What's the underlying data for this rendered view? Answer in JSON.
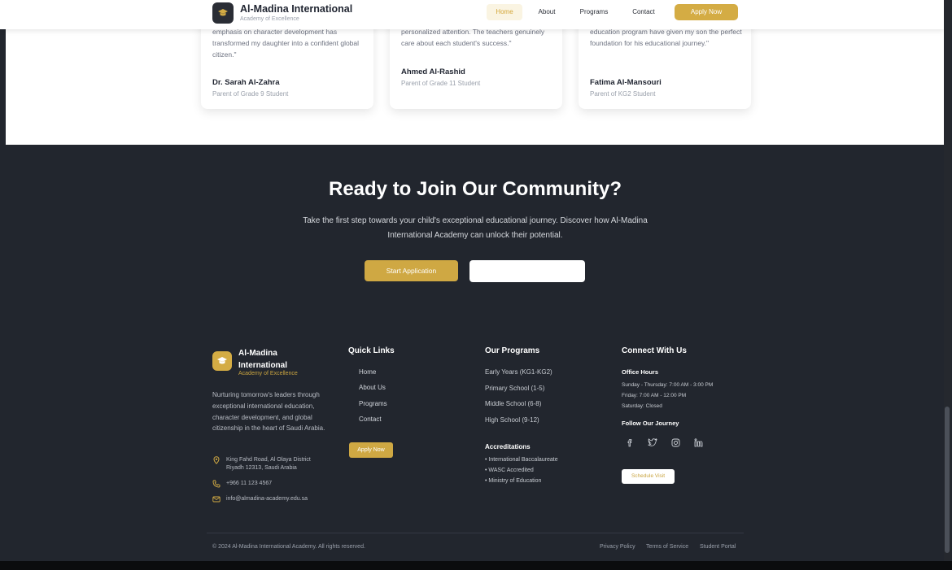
{
  "navbar": {
    "brand": "Al-Madina International",
    "tagline": "Academy of Excellence",
    "links": [
      "Home",
      "About",
      "Programs",
      "Contact"
    ],
    "apply": "Apply Now"
  },
  "testimonials": [
    {
      "quote": "emphasis on character development has transformed my daughter into a confident global citizen.\"",
      "author": "Dr. Sarah Al-Zahra",
      "role": "Parent of Grade 9 Student"
    },
    {
      "quote": "personalized attention. The teachers genuinely care about each student's success.\"",
      "author": "Ahmed Al-Rashid",
      "role": "Parent of Grade 11 Student"
    },
    {
      "quote": "education program have given my son the perfect foundation for his educational journey.\"",
      "author": "Fatima Al-Mansouri",
      "role": "Parent of KG2 Student"
    }
  ],
  "cta": {
    "title": "Ready to Join Our Community?",
    "description": "Take the first step towards your child's exceptional educational journey. Discover how Al-Madina International Academy can unlock their potential.",
    "start_button": "Start Application"
  },
  "footer": {
    "brand": "Al-Madina International",
    "tagline": "Academy of Excellence",
    "description": "Nurturing tomorrow's leaders through exceptional international education, character development, and global citizenship in the heart of Saudi Arabia.",
    "address": "King Fahd Road, Al Olaya District Riyadh 12313, Saudi Arabia",
    "phone": "+966 11 123 4567",
    "email": "info@almadina-academy.edu.sa",
    "quick_links": {
      "title": "Quick Links",
      "items": [
        "Home",
        "About Us",
        "Programs",
        "Contact"
      ],
      "apply": "Apply Now"
    },
    "programs": {
      "title": "Our Programs",
      "items": [
        "Early Years (KG1-KG2)",
        "Primary School (1-5)",
        "Middle School (6-8)",
        "High School (9-12)"
      ],
      "accreditations_title": "Accreditations",
      "accreditations": [
        "• International Baccalaureate",
        "• WASC Accredited",
        "• Ministry of Education"
      ]
    },
    "connect": {
      "title": "Connect With Us",
      "office_hours_title": "Office Hours",
      "hours": [
        "Sunday - Thursday: 7:00 AM - 3:00 PM",
        "Friday: 7:00 AM - 12:00 PM",
        "Saturday: Closed"
      ],
      "follow_title": "Follow Our Journey",
      "social_icons": [
        "facebook-icon",
        "twitter-icon",
        "instagram-icon",
        "linkedin-icon"
      ],
      "schedule_button": "Schedule Visit"
    },
    "copyright": "© 2024 Al-Madina International Academy. All rights reserved.",
    "legal_links": [
      "Privacy Policy",
      "Terms of Service",
      "Student Portal"
    ]
  },
  "colors": {
    "gold": "#d4ac44",
    "dark_bg": "#22262e",
    "white": "#ffffff"
  }
}
